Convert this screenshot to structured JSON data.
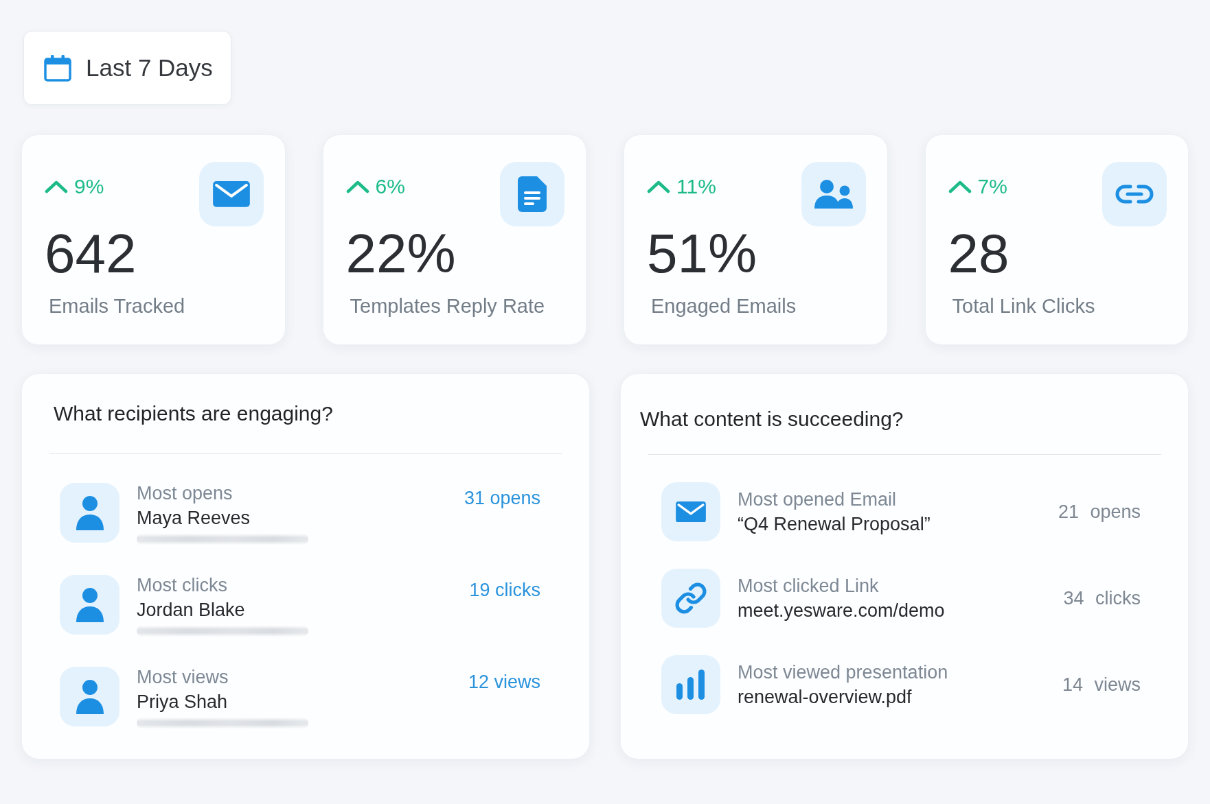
{
  "date_range": {
    "label": "Last 7 Days"
  },
  "stats": [
    {
      "trend": {
        "rising": true,
        "value": "9%"
      },
      "value": "642",
      "label": "Emails Tracked"
    },
    {
      "trend": {
        "rising": true,
        "value": "6%"
      },
      "value": "22%",
      "label": "Templates Reply Rate"
    },
    {
      "trend": {
        "rising": true,
        "value": "11%"
      },
      "value": "51%",
      "label": "Engaged Emails"
    },
    {
      "trend": {
        "rising": true,
        "value": "7%"
      },
      "value": "28",
      "label": "Total Link Clicks"
    }
  ],
  "recipients_panel": {
    "title": "What recipients are engaging?",
    "rows": [
      {
        "metric": "Most opens",
        "name": "Maya Reeves",
        "email_hidden": true,
        "result": "31 opens"
      },
      {
        "metric": "Most clicks",
        "name": "Jordan Blake",
        "email_hidden": true,
        "result": "19 clicks"
      },
      {
        "metric": "Most views",
        "name": "Priya Shah",
        "email_hidden": true,
        "result": "12 views"
      }
    ]
  },
  "content_panel": {
    "title": "What content is succeeding?",
    "rows": [
      {
        "metric": "Most opened Email",
        "item": "“Q4 Renewal Proposal”",
        "result": "21 opens"
      },
      {
        "metric": "Most clicked Link",
        "item": "meet.yesware.com/demo",
        "result": "34 clicks"
      },
      {
        "metric": "Most viewed presentation",
        "item": "renewal-overview.pdf",
        "result": "14 views"
      }
    ]
  }
}
